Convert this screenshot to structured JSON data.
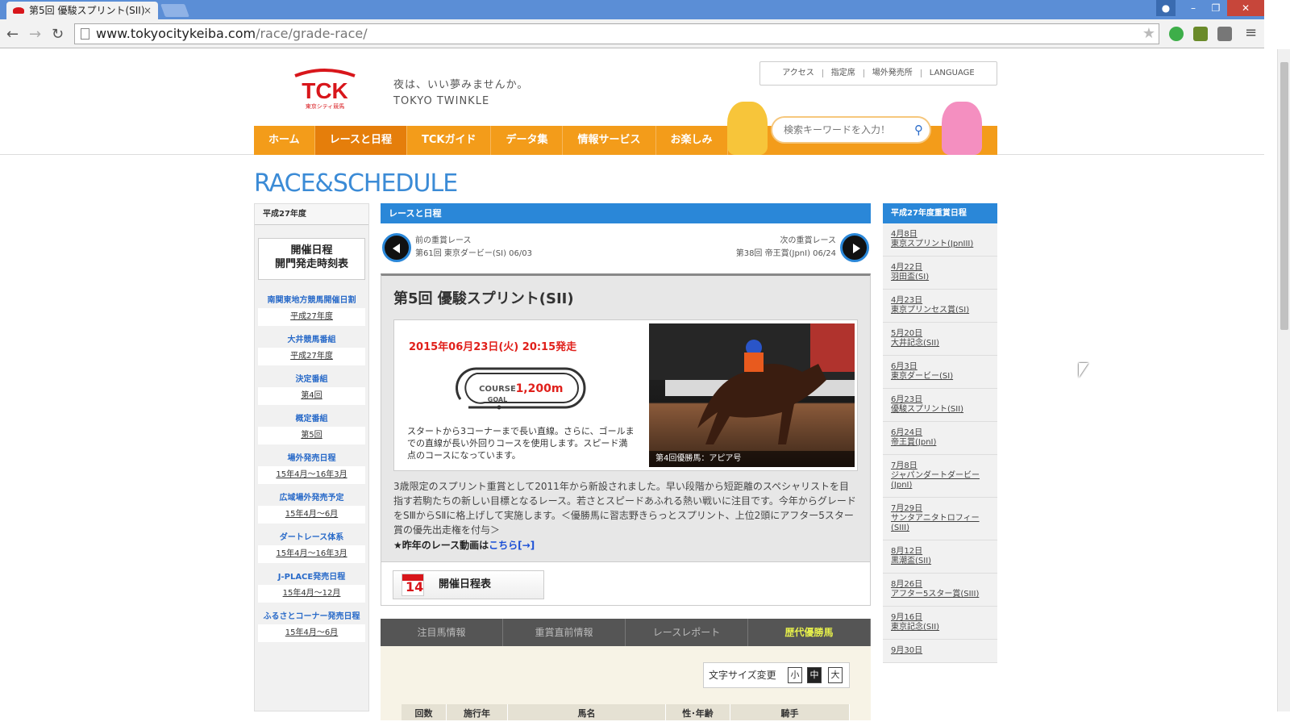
{
  "browser": {
    "tab_title": "第5回 優駿スプリント(SII)",
    "tab_close": "×",
    "url_domain": "www.tokyocitykeiba.com",
    "url_path": "/race/grade-race/"
  },
  "header": {
    "logo_text": "TCK",
    "logo_sub": "東京シティ競馬",
    "tagline_1": "夜は、いい夢みませんか。",
    "tagline_2": "TOKYO TWINKLE",
    "top_links": [
      "アクセス",
      "指定席",
      "場外発売所",
      "LANGUAGE"
    ],
    "nav": [
      "ホーム",
      "レースと日程",
      "TCKガイド",
      "データ集",
      "情報サービス",
      "お楽しみ"
    ],
    "search_placeholder": "検索キーワードを入力！"
  },
  "page_title": "RACE&SCHEDULE",
  "left": {
    "year": "平成27年度",
    "schedule_btn_1": "開催日程",
    "schedule_btn_2": "開門発走時刻表",
    "groups": [
      {
        "title": "南関東地方競馬開催日割",
        "link": "平成27年度"
      },
      {
        "title": "大井競馬番組",
        "link": "平成27年度"
      },
      {
        "title": "決定番組",
        "link": "第4回"
      },
      {
        "title": "概定番組",
        "link": "第5回"
      },
      {
        "title": "場外発売日程",
        "link": "15年4月～16年3月"
      },
      {
        "title": "広域場外発売予定",
        "link": "15年4月～6月"
      },
      {
        "title": "ダートレース体系",
        "link": "15年4月～16年3月"
      },
      {
        "title": "J-PLACE発売日程",
        "link": "15年4月～12月"
      },
      {
        "title": "ふるさとコーナー発売日程",
        "link": "15年4月～6月"
      }
    ]
  },
  "main": {
    "section_title": "レースと日程",
    "prev_label": "前の重賞レース",
    "prev_race": "第61回 東京ダービー(SI) 06/03",
    "next_label": "次の重賞レース",
    "next_race": "第38回 帝王賞(JpnI) 06/24",
    "race_title": "第5回 優駿スプリント(SII)",
    "race_date": "2015年06月23日(火) 20:15発走",
    "course_label": "COURSE",
    "course_goal": "GOAL",
    "course_distance": "1,200m",
    "course_desc": "スタートから3コーナーまで長い直線。さらに、ゴールまでの直線が長い外回りコースを使用します。スピード満点のコースになっています。",
    "photo_caption": "第4回優勝馬：アピア号",
    "description": "3歳限定のスプリント重賞として2011年から新設されました。早い段階から短距離のスペシャリストを目指す若駒たちの新しい目標となるレース。若さとスピードあふれる熱い戦いに注目です。今年からグレードをSⅢからSⅡに格上げして実施します。＜優勝馬に習志野きらっとスプリント、上位2頭にアフター5スター賞の優先出走権を付与＞",
    "video_prefix": "★昨年のレース動画は",
    "video_link": "こちら[→]",
    "calendar_btn": "開催日程表",
    "calendar_num": "14",
    "tabs": [
      "注目馬情報",
      "重賞直前情報",
      "レースレポート",
      "歴代優勝馬"
    ],
    "fontsize_label": "文字サイズ変更",
    "fontsize_small": "小",
    "fontsize_medium": "中",
    "fontsize_large": "大",
    "table_headers": [
      "回数",
      "施行年",
      "馬名",
      "性･年齢",
      "騎手"
    ]
  },
  "right": {
    "title": "平成27年度重賞日程",
    "items": [
      {
        "date": "4月8日",
        "race": "東京スプリント(JpnIII)"
      },
      {
        "date": "4月22日",
        "race": "羽田盃(SI)"
      },
      {
        "date": "4月23日",
        "race": "東京プリンセス賞(SI)"
      },
      {
        "date": "5月20日",
        "race": "大井記念(SII)"
      },
      {
        "date": "6月3日",
        "race": "東京ダービー(SI)"
      },
      {
        "date": "6月23日",
        "race": "優駿スプリント(SII)"
      },
      {
        "date": "6月24日",
        "race": "帝王賞(JpnI)"
      },
      {
        "date": "7月8日",
        "race": "ジャパンダートダービー(JpnI)"
      },
      {
        "date": "7月29日",
        "race": "サンタアニタトロフィー(SIII)"
      },
      {
        "date": "8月12日",
        "race": "黒潮盃(SII)"
      },
      {
        "date": "8月26日",
        "race": "アフター5スター賞(SIII)"
      },
      {
        "date": "9月16日",
        "race": "東京記念(SII)"
      },
      {
        "date": "9月30日",
        "race": ""
      }
    ]
  },
  "colors": {
    "accent_orange": "#f39c1a",
    "accent_blue": "#2a87d8",
    "tck_red": "#d8161b"
  }
}
